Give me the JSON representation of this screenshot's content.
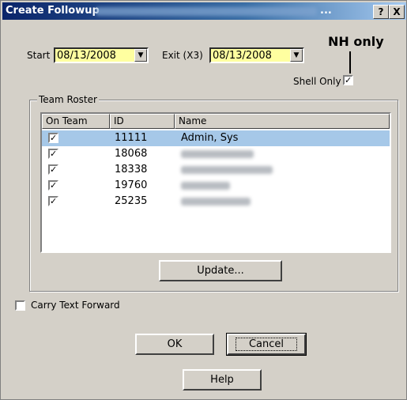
{
  "window": {
    "title": "Create Followup",
    "title_ellipsis": "...",
    "help_btn": "?",
    "close_btn": "X"
  },
  "start": {
    "label": "Start",
    "value": "08/13/2008"
  },
  "exit": {
    "label": "Exit (X3)",
    "value": "08/13/2008"
  },
  "annotation": "NH only",
  "shell_only": {
    "label": "Shell Only",
    "checked": true
  },
  "roster": {
    "title": "Team Roster",
    "columns": [
      "On Team",
      "ID",
      "Name"
    ],
    "rows": [
      {
        "id": "11111",
        "name": "Admin, Sys"
      },
      {
        "id": "18068",
        "name": ""
      },
      {
        "id": "18338",
        "name": ""
      },
      {
        "id": "19760",
        "name": ""
      },
      {
        "id": "25235",
        "name": ""
      }
    ],
    "check_mark": "✓"
  },
  "buttons": {
    "update": "Update...",
    "ok": "OK",
    "cancel": "Cancel",
    "help": "Help"
  },
  "carry_text": {
    "label": "Carry Text Forward",
    "checked": false
  },
  "colors": {
    "title_start": "#0a246a",
    "date_bg": "#ffffa0",
    "selected_row": "#a6c8e8"
  }
}
